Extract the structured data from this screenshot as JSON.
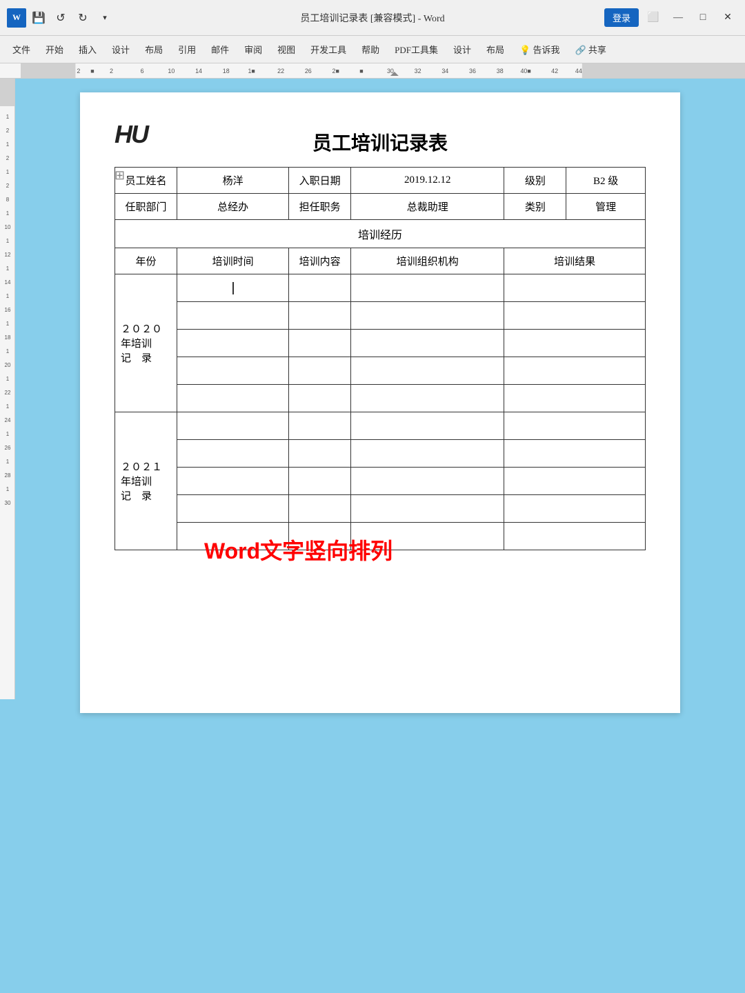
{
  "titlebar": {
    "title": "员工培训记录表 [兼容模式] - Word",
    "login": "登录",
    "undo": "↺",
    "redo": "↻",
    "save_icon": "💾",
    "minimize": "—",
    "maximize": "□",
    "close": "✕"
  },
  "menubar": {
    "items": [
      "文件",
      "开始",
      "插入",
      "设计",
      "布局",
      "引用",
      "邮件",
      "审阅",
      "视图",
      "开发工具",
      "帮助",
      "PDF工具集",
      "设计",
      "布局",
      "💡告诉我",
      "共享"
    ]
  },
  "document": {
    "logo": "HU",
    "title": "员工培训记录表",
    "rows": {
      "info1": {
        "label1": "员工姓名",
        "val1": "杨洋",
        "label2": "入职日期",
        "val2": "2019.12.12",
        "label3": "级别",
        "val3": "B2 级"
      },
      "info2": {
        "label1": "任职部门",
        "val1": "总经办",
        "label2": "担任职务",
        "val2": "总裁助理",
        "label3": "类别",
        "val3": "管理"
      },
      "training_header": "培训经历",
      "col_headers": [
        "年份",
        "培训时间",
        "培训内容",
        "培训组织机构",
        "培训结果"
      ],
      "year2020": "２０２０\n年培训\n记　录",
      "year2021": "２０２１\n年培训\n记　录"
    }
  },
  "overlay": {
    "text": "Word文字竖向排列"
  }
}
